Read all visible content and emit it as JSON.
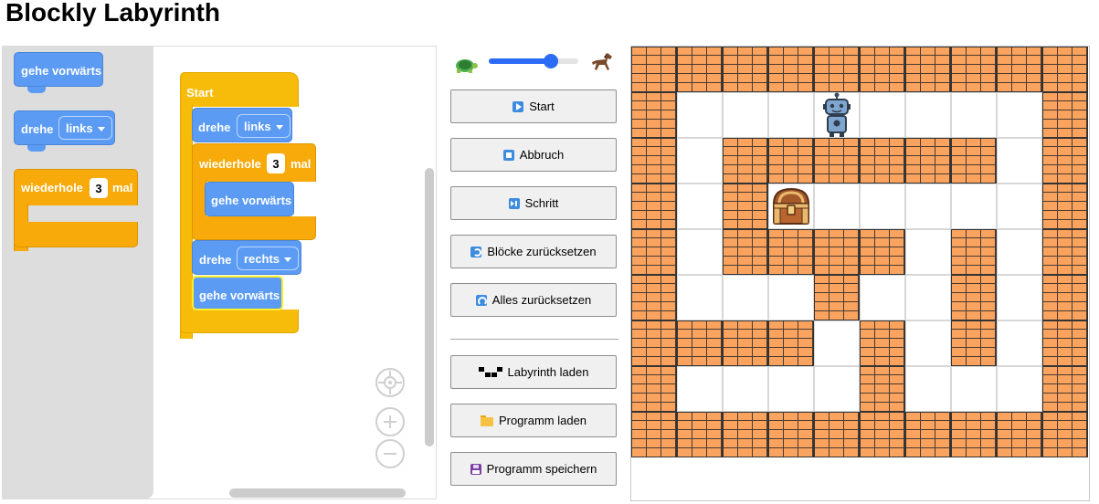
{
  "title": "Blockly Labyrinth",
  "toolbox": {
    "move_label": "gehe vorwärts",
    "turn_label": "drehe",
    "turn_option": "links",
    "repeat_label": "wiederhole",
    "repeat_count": "3",
    "repeat_suffix": "mal"
  },
  "program": {
    "start_label": "Start",
    "turn1_label": "drehe",
    "turn1_option": "links",
    "repeat_label": "wiederhole",
    "repeat_count": "3",
    "repeat_suffix": "mal",
    "move_inner_label": "gehe vorwärts",
    "turn2_label": "drehe",
    "turn2_option": "rechts",
    "move_last_label": "gehe vorwärts"
  },
  "speed": {
    "level": 0.73
  },
  "controls": {
    "start": "Start",
    "abort": "Abbruch",
    "step": "Schritt",
    "reset_blocks": "Blöcke zurücksetzen",
    "reset_all": "Alles zurücksetzen",
    "load_maze": "Labyrinth laden",
    "load_program": "Programm laden",
    "save_program": "Programm speichern"
  },
  "maze": {
    "rows": [
      "##########",
      "#...R....#",
      "#.######.#",
      "#.#C.....#",
      "#.####.#.#",
      "#...#..#.#",
      "####.#.#.#",
      "#....#...#",
      "##########"
    ],
    "legend": {
      "#": "wall",
      ".": "open",
      "R": "robot",
      "C": "treasure-chest"
    }
  },
  "colors": {
    "motion_block": "#5b9bf4",
    "loop_block": "#f7aa0a",
    "start_block": "#f7bc0a",
    "wall": "#f9a35f",
    "slider": "#2b6bf5"
  }
}
